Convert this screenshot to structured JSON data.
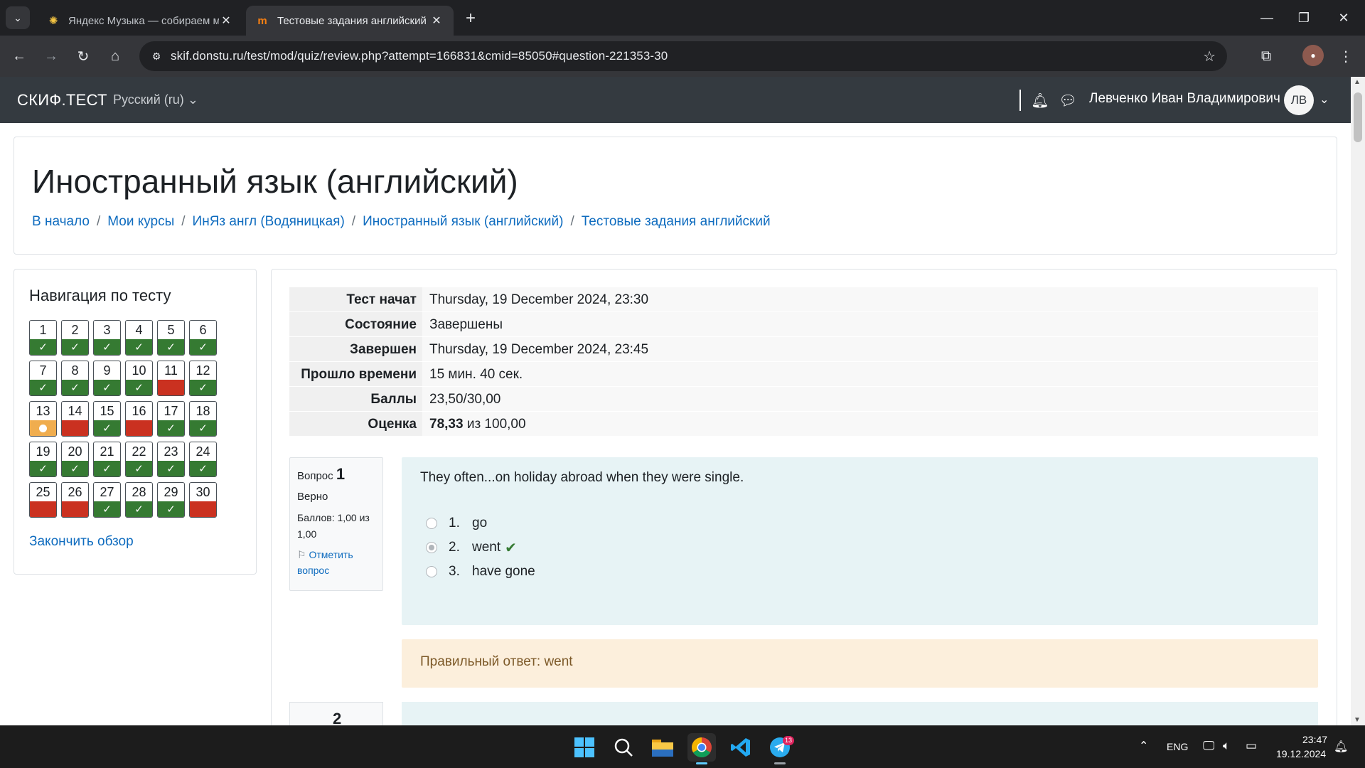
{
  "browser": {
    "tabs": [
      {
        "title": "Яндекс Музыка — собираем м",
        "favicon": "yandex-music-icon",
        "active": false
      },
      {
        "title": "Тестовые задания английский",
        "favicon": "moodle-icon",
        "active": true
      }
    ],
    "url": "skif.donstu.ru/test/mod/quiz/review.php?attempt=166831&cmid=85050#question-221353-30"
  },
  "navbar": {
    "brand": "СКИФ.ТЕСТ",
    "language": "Русский ‎(ru)‎",
    "user_name": "Левченко Иван Владимирович",
    "user_initials": "ЛВ"
  },
  "page": {
    "title": "Иностранный язык (английский)",
    "breadcrumb": [
      "В начало",
      "Мои курсы",
      "ИнЯз англ (Водяницкая)",
      "Иностранный язык (английский)",
      "Тестовые задания английский"
    ]
  },
  "quiz_nav": {
    "title": "Навигация по тесту",
    "questions": [
      {
        "n": "1",
        "state": "correct"
      },
      {
        "n": "2",
        "state": "correct"
      },
      {
        "n": "3",
        "state": "correct"
      },
      {
        "n": "4",
        "state": "correct"
      },
      {
        "n": "5",
        "state": "correct"
      },
      {
        "n": "6",
        "state": "correct"
      },
      {
        "n": "7",
        "state": "correct"
      },
      {
        "n": "8",
        "state": "correct"
      },
      {
        "n": "9",
        "state": "correct"
      },
      {
        "n": "10",
        "state": "correct"
      },
      {
        "n": "11",
        "state": "incorrect"
      },
      {
        "n": "12",
        "state": "correct"
      },
      {
        "n": "13",
        "state": "partial"
      },
      {
        "n": "14",
        "state": "incorrect"
      },
      {
        "n": "15",
        "state": "correct"
      },
      {
        "n": "16",
        "state": "incorrect"
      },
      {
        "n": "17",
        "state": "correct"
      },
      {
        "n": "18",
        "state": "correct"
      },
      {
        "n": "19",
        "state": "correct"
      },
      {
        "n": "20",
        "state": "correct"
      },
      {
        "n": "21",
        "state": "correct"
      },
      {
        "n": "22",
        "state": "correct"
      },
      {
        "n": "23",
        "state": "correct"
      },
      {
        "n": "24",
        "state": "correct"
      },
      {
        "n": "25",
        "state": "incorrect"
      },
      {
        "n": "26",
        "state": "incorrect"
      },
      {
        "n": "27",
        "state": "correct"
      },
      {
        "n": "28",
        "state": "correct"
      },
      {
        "n": "29",
        "state": "correct"
      },
      {
        "n": "30",
        "state": "incorrect"
      }
    ],
    "finish_label": "Закончить обзор"
  },
  "summary": {
    "started_label": "Тест начат",
    "started_value": "Thursday, 19 December 2024, 23:30",
    "state_label": "Состояние",
    "state_value": "Завершены",
    "completed_label": "Завершен",
    "completed_value": "Thursday, 19 December 2024, 23:45",
    "time_label": "Прошло времени",
    "time_value": "15 мин. 40 сек.",
    "marks_label": "Баллы",
    "marks_value": "23,50/30,00",
    "grade_label": "Оценка",
    "grade_value": "78,33",
    "grade_suffix": " из 100,00"
  },
  "question1": {
    "label": "Вопрос",
    "number": "1",
    "state": "Верно",
    "grade": "Баллов: 1,00 из 1,00",
    "flag": "Отметить вопрос",
    "text": "They often...on holiday abroad when they were single.",
    "answers": [
      {
        "num": "1.",
        "text": "go",
        "checked": false,
        "correct": false
      },
      {
        "num": "2.",
        "text": "went",
        "checked": true,
        "correct": true
      },
      {
        "num": "3.",
        "text": "have gone",
        "checked": false,
        "correct": false
      }
    ],
    "right_answer": "Правильный ответ: went"
  },
  "question2": {
    "number": "2"
  },
  "taskbar": {
    "language": "ENG",
    "time": "23:47",
    "date": "19.12.2024",
    "telegram_badge": "13"
  },
  "colors": {
    "correct": "#357a32",
    "incorrect": "#ca3120",
    "partial": "#f0ad4e",
    "link": "#0f6cbf"
  }
}
